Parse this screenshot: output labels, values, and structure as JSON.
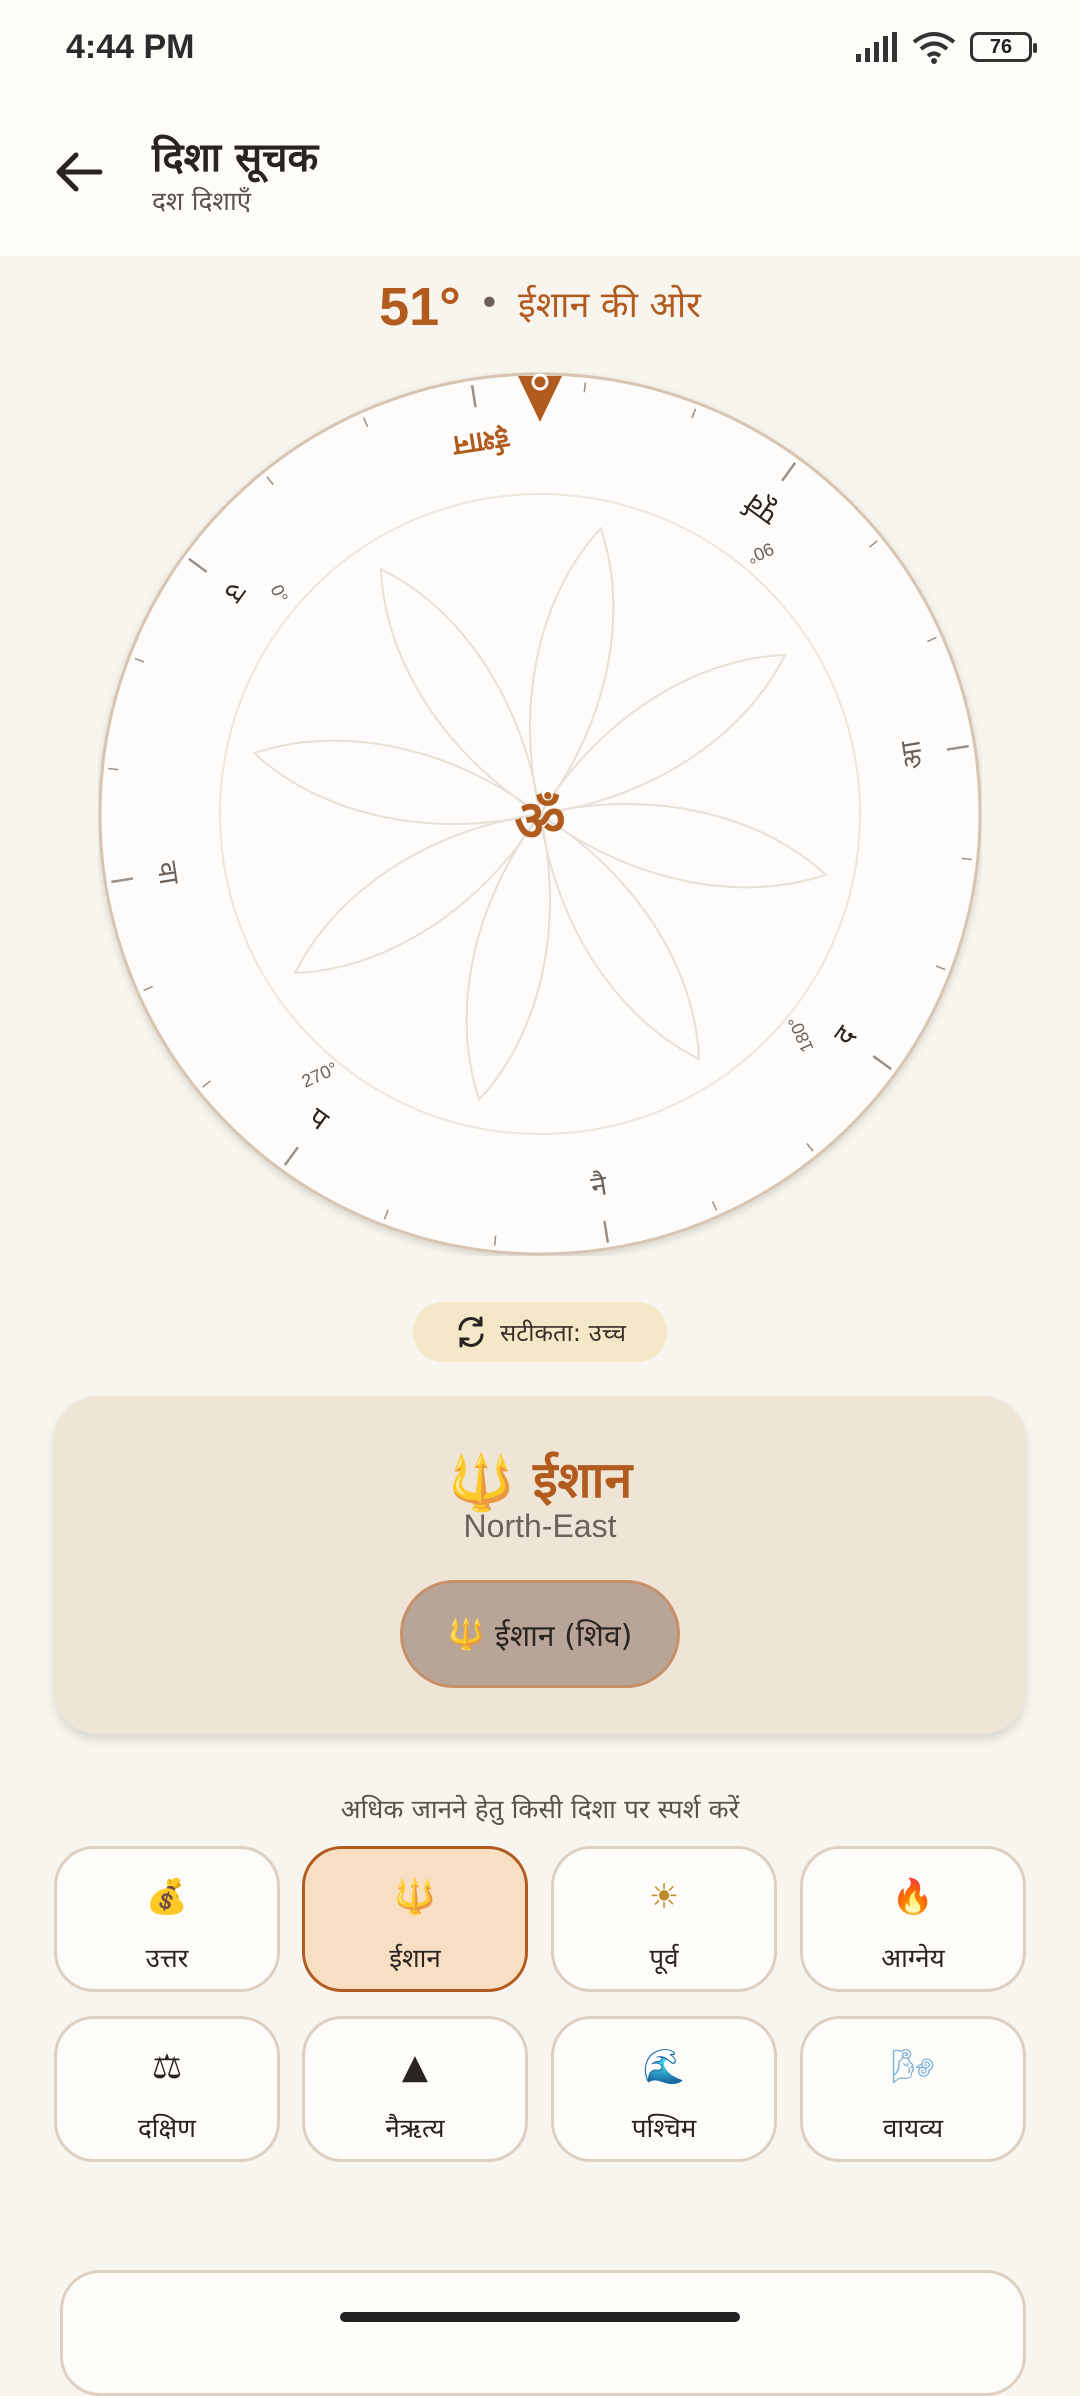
{
  "status_bar": {
    "time": "4:44 PM",
    "battery": "76"
  },
  "app_bar": {
    "title": "दिशा सूचक",
    "subtitle": "दश दिशाएँ"
  },
  "heading": {
    "degrees": "51°",
    "separator": "•",
    "direction_text": "ईशान की ओर"
  },
  "compass": {
    "center_symbol": "ॐ",
    "marker_color": "#b25b1f",
    "labels": [
      {
        "text": "ईशान",
        "degree": ""
      },
      {
        "text": "पूर्व",
        "degree": "90°"
      },
      {
        "text": "आ",
        "degree": ""
      },
      {
        "text": "द",
        "degree": "180°"
      },
      {
        "text": "नै",
        "degree": ""
      },
      {
        "text": "प",
        "degree": "270°"
      },
      {
        "text": "वा",
        "degree": ""
      },
      {
        "text": "उ",
        "degree": "0°"
      }
    ]
  },
  "accuracy": {
    "label": "सटीकता: उच्च",
    "icon": "rotate-icon"
  },
  "direction_card": {
    "emoji": "🔱",
    "name": "ईशान",
    "english": "North-East",
    "deity_emoji": "🔱",
    "deity": "ईशान (शिव)"
  },
  "hint": "अधिक जानने हेतु किसी दिशा पर स्पर्श करें",
  "directions": [
    {
      "icon": "💰",
      "label": "उत्तर",
      "selected": false
    },
    {
      "icon": "🔱",
      "label": "ईशान",
      "selected": true
    },
    {
      "icon": "☀",
      "label": "पूर्व",
      "selected": false
    },
    {
      "icon": "🔥",
      "label": "आग्नेय",
      "selected": false
    },
    {
      "icon": "⚖",
      "label": "दक्षिण",
      "selected": false
    },
    {
      "icon": "▲",
      "label": "नैऋत्य",
      "selected": false
    },
    {
      "icon": "🌊",
      "label": "पश्चिम",
      "selected": false
    },
    {
      "icon": "🌬",
      "label": "वायव्य",
      "selected": false
    }
  ]
}
